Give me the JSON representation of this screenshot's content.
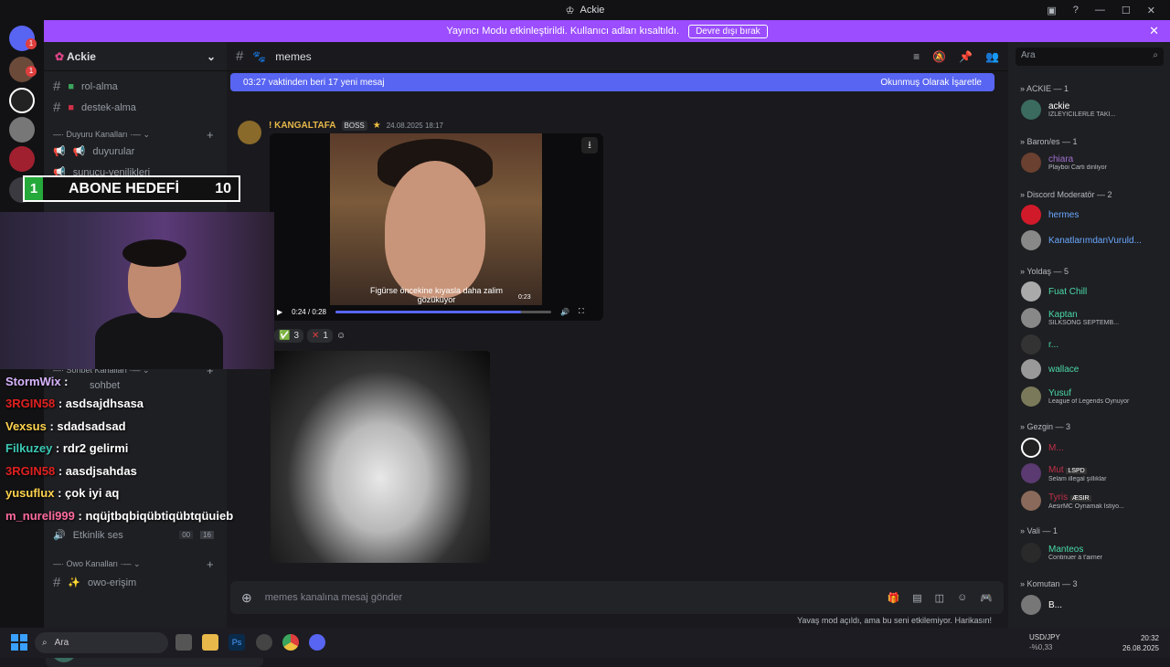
{
  "window": {
    "title": "Ackie"
  },
  "banner": {
    "text": "Yayıncı Modu etkinleştirildi. Kullanıcı adları kısaltıldı.",
    "button": "Devre dışı bırak"
  },
  "server": {
    "name": "Ackie"
  },
  "channels": {
    "rol_alma": "rol-alma",
    "destek_alma": "destek-alma",
    "cat_duyuru": "Duyuru Kanalları",
    "duyurular": "duyurular",
    "sunucu": "sunucu-yenilikleri",
    "cat_sohbet": "Sohbet Kanalları",
    "sohbet": "sohbet",
    "etkinlik": "Etkinlik ses",
    "etkinlik_count_a": "00",
    "etkinlik_count_b": "16",
    "cat_owo": "Owo Kanalları",
    "owo": "owo-erişim"
  },
  "user": {
    "name": "ackie",
    "status": "İZLEYİCİLERLE TAKILMACA ..."
  },
  "channel_header": {
    "name": "memes"
  },
  "newbar": {
    "left": "03:27 vaktinden beri 17 yeni mesaj",
    "right": "Okunmuş Olarak İşaretle"
  },
  "message": {
    "author": "! KANGALTAFA",
    "tag": "BOSS",
    "date": "24.08.2025 18:17",
    "subtitle": "Figürse öncekine kıyasla daha zalim gözüküyor",
    "time": "0:24 / 0:28",
    "hover_time": "0:23",
    "progress": 0.86,
    "check_count": "3",
    "cross_count": "1"
  },
  "composer": {
    "placeholder": "memes kanalına mesaj gönder"
  },
  "slowmode": "Yavaş mod açıldı, ama bu seni etkilemiyor. Harikasın!",
  "members_search": "Ara",
  "members": {
    "cat1": "» ACKIE — 1",
    "ackie": "ackie",
    "ackie_sub": "İZLEYİCİLERLE TAKI...",
    "cat2": "» Baron/es — 1",
    "chiara": "chiara",
    "chiara_sub": "Playboi Carti dinliyor",
    "cat3": "» Discord Moderatör — 2",
    "hermes": "hermes",
    "kanat": "KanatlarımdanVuruld...",
    "cat4": "» Yoldaş — 5",
    "fuat": "Fuat Chill",
    "kaptan": "Kaptan",
    "kaptan_sub": "SILKSONG SEPTEMB...",
    "r": "r...",
    "wallace": "wallace",
    "yusuf": "Yusuf",
    "yusuf_sub": "League of Legends Oynuyor",
    "cat5": "» Gezgin — 3",
    "m": "M...",
    "mut": "Mut",
    "mut_tag": "LSPD",
    "mut_sub": "Selam illegal şıllıklar",
    "tyris": "Tyris",
    "tyris_tag": "ÆSIR",
    "tyris_sub": "AesirMC Oynamak İstiyo...",
    "cat6": "» Vali — 1",
    "manteos": "Manteos",
    "manteos_sub": "Continuer à t'aimer",
    "cat7": "» Komutan — 3",
    "b": "B..."
  },
  "overlay": {
    "abone_num": "1",
    "abone_label": "ABONE HEDEFİ",
    "abone_count": "10",
    "chat": [
      {
        "user": "StormWix",
        "msg": ":",
        "color": "#d8b4ff"
      },
      {
        "user": "3RGIN58",
        "msg": ": asdsajdhsasa",
        "color": "#e02020"
      },
      {
        "user": "Vexsus",
        "msg": ": sdadsadsad",
        "color": "#ffd34d"
      },
      {
        "user": "Filkuzey",
        "msg": ": rdr2 gelirmi",
        "color": "#3cc8b4"
      },
      {
        "user": "3RGIN58",
        "msg": ": aasdjsahdas",
        "color": "#e02020"
      },
      {
        "user": "yusuflux",
        "msg": ": çok iyi aq",
        "color": "#ffd34d"
      },
      {
        "user": "m_nureli999",
        "msg": ": nqüjtbqbiqübtiqübtqüuieb",
        "color": "#ff6b9e"
      }
    ]
  },
  "taskbar": {
    "search": "Ara",
    "forex_label": "USD/JPY",
    "forex_value": "-%0,33",
    "time": "20:32",
    "date": "26.08.2025"
  }
}
